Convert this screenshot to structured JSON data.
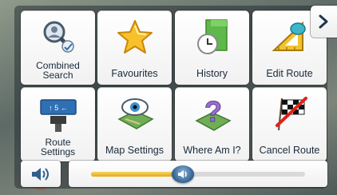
{
  "menu": {
    "tiles": [
      {
        "label": "Combined\nSearch",
        "icon": "search-person-icon"
      },
      {
        "label": "Favourites",
        "icon": "star-icon"
      },
      {
        "label": "History",
        "icon": "history-icon"
      },
      {
        "label": "Edit Route",
        "icon": "edit-route-icon"
      },
      {
        "label": "Route\nSettings",
        "icon": "route-settings-icon"
      },
      {
        "label": "Map Settings",
        "icon": "map-settings-icon"
      },
      {
        "label": "Where Am I?",
        "icon": "where-am-i-icon"
      },
      {
        "label": "Cancel Route",
        "icon": "cancel-route-icon"
      }
    ],
    "next_page_icon": "chevron-right-icon"
  },
  "volume": {
    "icon": "speaker-icon",
    "level": 0.43
  },
  "colors": {
    "tile_text": "#1a2a3a",
    "slider_fill": "#e2aa1e",
    "handle": "#2f5f8e"
  }
}
